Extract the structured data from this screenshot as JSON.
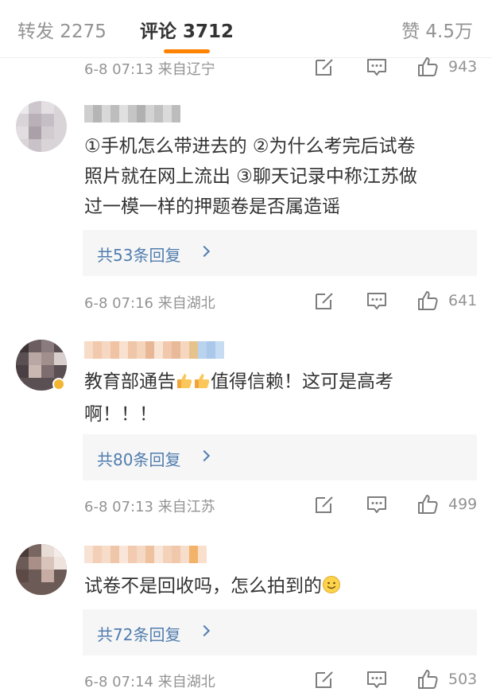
{
  "tabs": {
    "repost": "转发 2275",
    "comment": "评论 3712",
    "like": "赞 4.5万",
    "accent": "#ff8200"
  },
  "top_meta": {
    "time": "6-8 07:13  来自辽宁",
    "likes": "943"
  },
  "comments": [
    {
      "text_line1": "①手机怎么带进去的 ②为什么考完后试卷",
      "text_line2": "照片就在网上流出 ③聊天记录中称江苏做",
      "text_line3": "过一模一样的押题卷是否属造谣",
      "replies_label": "共53条回复",
      "time": "6-8 07:16  来自湖北",
      "likes": "641"
    },
    {
      "text_line1a": "教育部通告",
      "text_line1b": "值得信赖！这可是高考",
      "text_line2": "啊！！！",
      "emoji": "thumbs-up-icon",
      "replies_label": "共80条回复",
      "time": "6-8 07:13  来自江苏",
      "likes": "499"
    },
    {
      "text_line1": "试卷不是回收吗，怎么拍到的",
      "emoji": "smile-icon",
      "replies_label": "共72条回复",
      "time": "6-8 07:14  来自湖北",
      "likes": "503"
    }
  ],
  "icons": {
    "edit": "edit-icon",
    "reply": "comment-icon",
    "like": "thumbs-up-icon",
    "more": "chevron-right-icon"
  },
  "colors": {
    "link": "#507daf",
    "meta": "#939393",
    "text": "#333333",
    "reply_bg": "#f6f6f6"
  }
}
